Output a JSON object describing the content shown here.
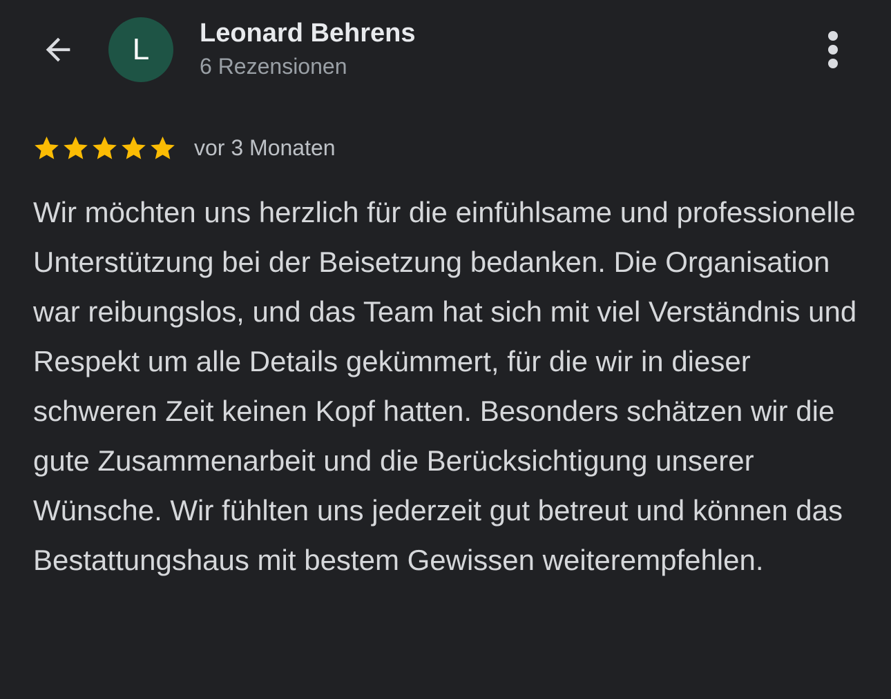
{
  "header": {
    "back_icon": "arrow-left-icon",
    "avatar_initial": "L",
    "avatar_color": "#1e5445",
    "author_name": "Leonard Behrens",
    "author_meta": "6 Rezensionen",
    "more_icon": "more-vert-icon"
  },
  "review": {
    "rating": 5,
    "max_rating": 5,
    "star_color": "#fbbc04",
    "date": "vor 3 Monaten",
    "text": "Wir möchten uns herzlich für die einfühlsame und professionelle Unterstützung bei der Beisetzung bedanken. Die Organisation war reibungslos, und das Team hat sich mit viel Verständnis und Respekt um alle Details gekümmert, für die wir in dieser schweren Zeit keinen Kopf hatten. Besonders schätzen wir die gute Zusammenarbeit und die Berücksichtigung unserer Wünsche. Wir fühlten uns jederzeit gut betreut und können das Bestattungshaus mit bestem Gewissen weiterempfehlen."
  }
}
